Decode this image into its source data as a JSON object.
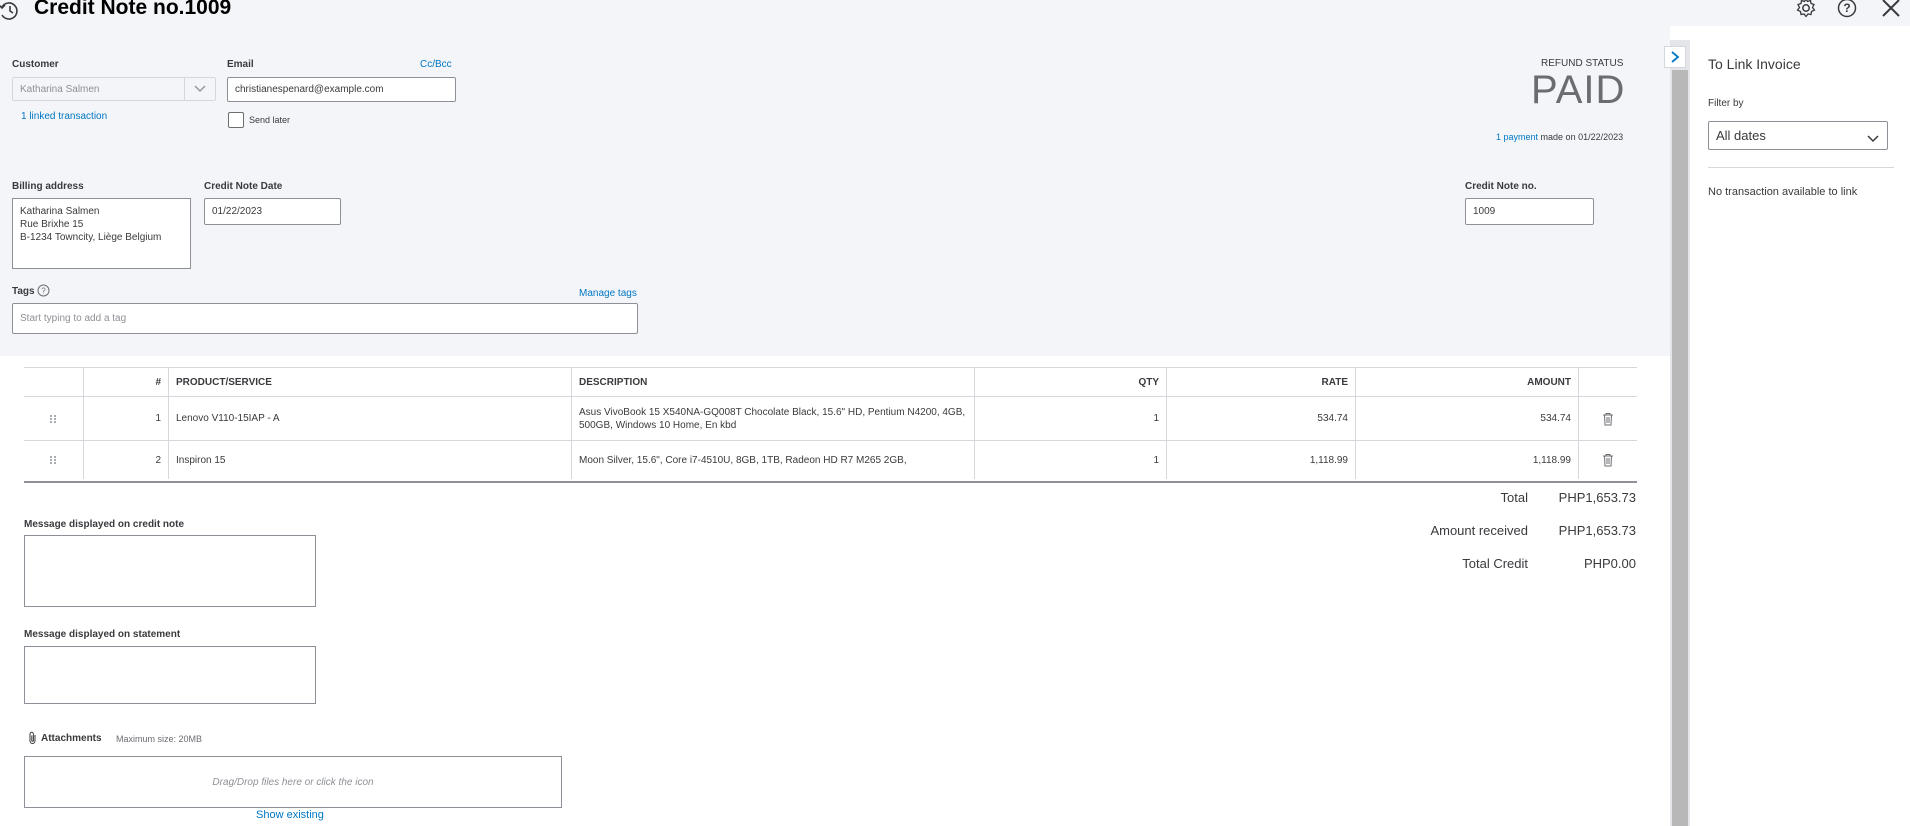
{
  "header": {
    "title": "Credit Note no.1009"
  },
  "customer": {
    "label": "Customer",
    "value": "Katharina Salmen",
    "linked": "1 linked transaction"
  },
  "email": {
    "label": "Email",
    "ccbcc": "Cc/Bcc",
    "value": "christianespenard@example.com",
    "send_later": "Send later"
  },
  "refund": {
    "label": "REFUND STATUS",
    "status": "PAID",
    "payment_link": "1 payment",
    "payment_text": "made on 01/22/2023"
  },
  "billing": {
    "label": "Billing address",
    "line1": "Katharina Salmen",
    "line2": "Rue Brixhe 15",
    "line3": "B-1234 Towncity, Liège Belgium"
  },
  "date": {
    "label": "Credit Note Date",
    "value": "01/22/2023"
  },
  "creditno": {
    "label": "Credit Note no.",
    "value": "1009"
  },
  "tags": {
    "label": "Tags",
    "manage": "Manage tags",
    "placeholder": "Start typing to add a tag"
  },
  "table": {
    "columns": [
      "#",
      "PRODUCT/SERVICE",
      "DESCRIPTION",
      "QTY",
      "RATE",
      "AMOUNT"
    ],
    "rows": [
      {
        "num": "1",
        "product": "Lenovo V110-15IAP - A",
        "desc": "Asus VivoBook 15 X540NA-GQ008T Chocolate Black, 15.6\" HD, Pentium N4200, 4GB, 500GB, Windows 10 Home, En kbd",
        "qty": "1",
        "rate": "534.74",
        "amount": "534.74"
      },
      {
        "num": "2",
        "product": "Inspiron 15",
        "desc": "Moon Silver, 15.6\", Core i7-4510U, 8GB, 1TB, Radeon HD R7 M265 2GB,",
        "qty": "1",
        "rate": "1,118.99",
        "amount": "1,118.99"
      }
    ]
  },
  "totals": {
    "total_label": "Total",
    "total_value": "PHP1,653.73",
    "received_label": "Amount received",
    "received_value": "PHP1,653.73",
    "credit_label": "Total Credit",
    "credit_value": "PHP0.00"
  },
  "messages": {
    "credit_note": "Message displayed on credit note",
    "statement": "Message displayed on statement"
  },
  "attachments": {
    "label": "Attachments",
    "max": "Maximum size: 20MB",
    "drop": "Drag/Drop files here or click the icon",
    "show_existing": "Show existing"
  },
  "panel": {
    "title": "To Link Invoice",
    "filter_label": "Filter by",
    "filter_value": "All dates",
    "empty": "No transaction available to link"
  },
  "icons": {
    "history": "history-icon",
    "settings": "gear-icon",
    "help": "help-icon",
    "close": "close-icon",
    "delete": "trash-icon",
    "drag": "drag-handle-icon",
    "attach": "paperclip-icon",
    "collapse": "chevron-right-icon",
    "dropdown": "chevron-down-icon"
  },
  "colors": {
    "accent": "#0077c5",
    "header_bg": "#f4f5f8"
  }
}
